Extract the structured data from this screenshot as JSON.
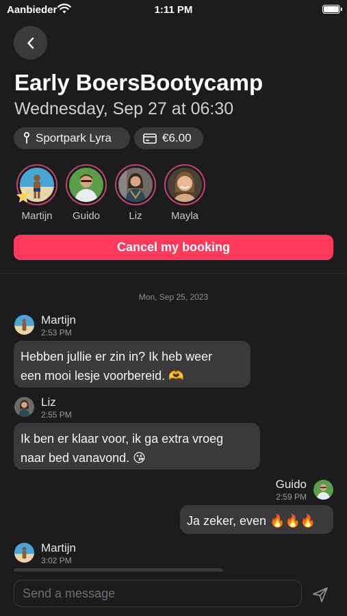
{
  "status_bar": {
    "carrier": "Aanbieder",
    "time": "1:11 PM"
  },
  "event": {
    "title": "Early BoersBootycamp",
    "datetime": "Wednesday, Sep 27 at 06:30",
    "location": "Sportpark Lyra",
    "price": "€6.00"
  },
  "participants": [
    {
      "name": "Martijn",
      "host": true
    },
    {
      "name": "Guido"
    },
    {
      "name": "Liz"
    },
    {
      "name": "Mayla"
    }
  ],
  "actions": {
    "cancel_label": "Cancel my booking"
  },
  "chat": {
    "day_label": "Mon, Sep 25, 2023",
    "messages": [
      {
        "author": "Martijn",
        "time": "2:53 PM",
        "lines": [
          "Hebben jullie er zin in? Ik heb weer",
          "een mooi lesje voorbereid. 🫶"
        ]
      },
      {
        "author": "Liz",
        "time": "2:55 PM",
        "lines": [
          "Ik ben er klaar voor, ik ga extra vroeg",
          "naar bed vanavond. 😘"
        ]
      },
      {
        "author": "Guido",
        "time": "2:59 PM",
        "lines": [
          "Ja zeker, even"
        ],
        "emoji": "🔥🔥🔥"
      },
      {
        "author": "Martijn",
        "time": "3:02 PM"
      }
    ]
  },
  "composer": {
    "placeholder": "Send a message"
  },
  "colors": {
    "accent": "#fd3a5c",
    "background": "#1c1c1e",
    "bubble": "#3a3a3c",
    "avatar_ring": "#c4456c"
  },
  "icons": {
    "back": "chevron-left-icon",
    "location": "pin-icon",
    "price": "credit-card-icon",
    "send": "send-icon",
    "host": "star-icon"
  }
}
